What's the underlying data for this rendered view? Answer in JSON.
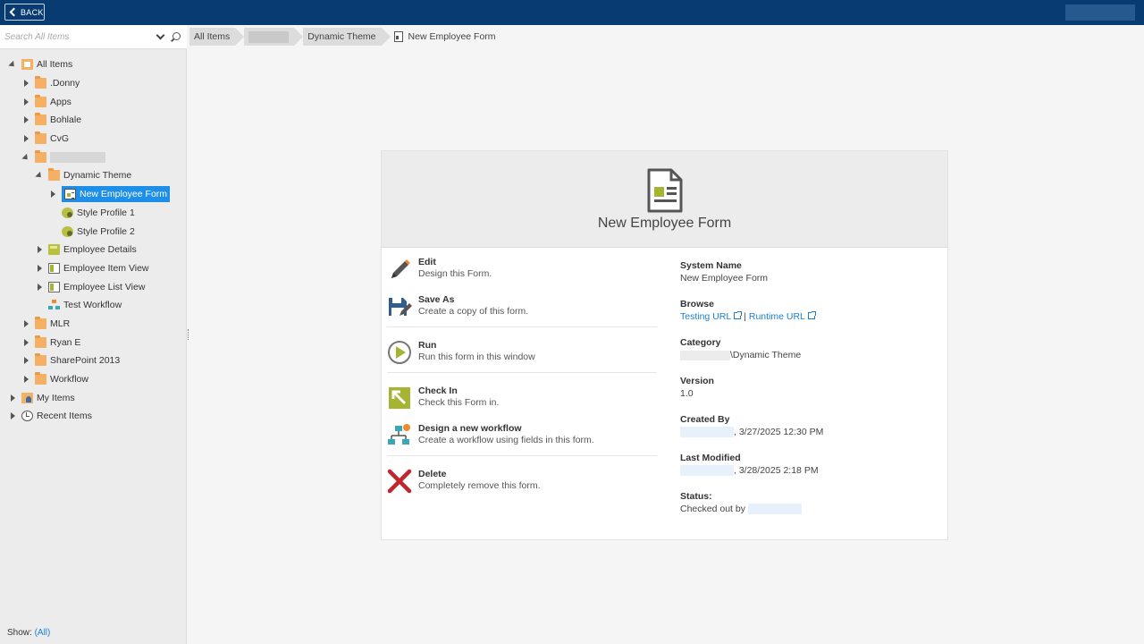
{
  "topbar": {
    "back_label": "BACK"
  },
  "search": {
    "placeholder": "Search All Items"
  },
  "tree": {
    "all_items": "All Items",
    "donny": ".Donny",
    "apps": "Apps",
    "bohlale": "Bohlale",
    "cvg": "CvG",
    "dynamic_theme": "Dynamic Theme",
    "new_employee_form": "New Employee Form",
    "style_profile_1": "Style Profile 1",
    "style_profile_2": "Style Profile 2",
    "employee_details": "Employee Details",
    "employee_item_view": "Employee Item View",
    "employee_list_view": "Employee List View",
    "test_workflow": "Test Workflow",
    "mlr": "MLR",
    "ryan_e": "Ryan E",
    "sharepoint_2013": "SharePoint 2013",
    "workflow": "Workflow",
    "my_items": "My Items",
    "recent_items": "Recent Items"
  },
  "show": {
    "label": "Show:",
    "value": "(All)"
  },
  "breadcrumb": {
    "root": "All Items",
    "theme": "Dynamic Theme",
    "current": "New Employee Form"
  },
  "card": {
    "title": "New Employee Form",
    "actions": {
      "edit_title": "Edit",
      "edit_desc": "Design this Form.",
      "saveas_title": "Save As",
      "saveas_desc": "Create a copy of this form.",
      "run_title": "Run",
      "run_desc": "Run this form in this window",
      "checkin_title": "Check In",
      "checkin_desc": "Check this Form in.",
      "workflow_title": "Design a new workflow",
      "workflow_desc": "Create a workflow using fields in this form.",
      "delete_title": "Delete",
      "delete_desc": "Completely remove this form."
    },
    "props": {
      "system_name_label": "System Name",
      "system_name": "New Employee Form",
      "browse_label": "Browse",
      "testing_url": "Testing URL",
      "sep": "|",
      "runtime_url": "Runtime URL",
      "category_label": "Category",
      "category": "\\Dynamic Theme",
      "version_label": "Version",
      "version": "1.0",
      "created_by_label": "Created By",
      "created_on": ", 3/27/2025 12:30 PM",
      "last_modified_label": "Last Modified",
      "modified_on": ", 3/28/2025 2:18 PM",
      "status_label": "Status:",
      "status": "Checked out by"
    }
  }
}
